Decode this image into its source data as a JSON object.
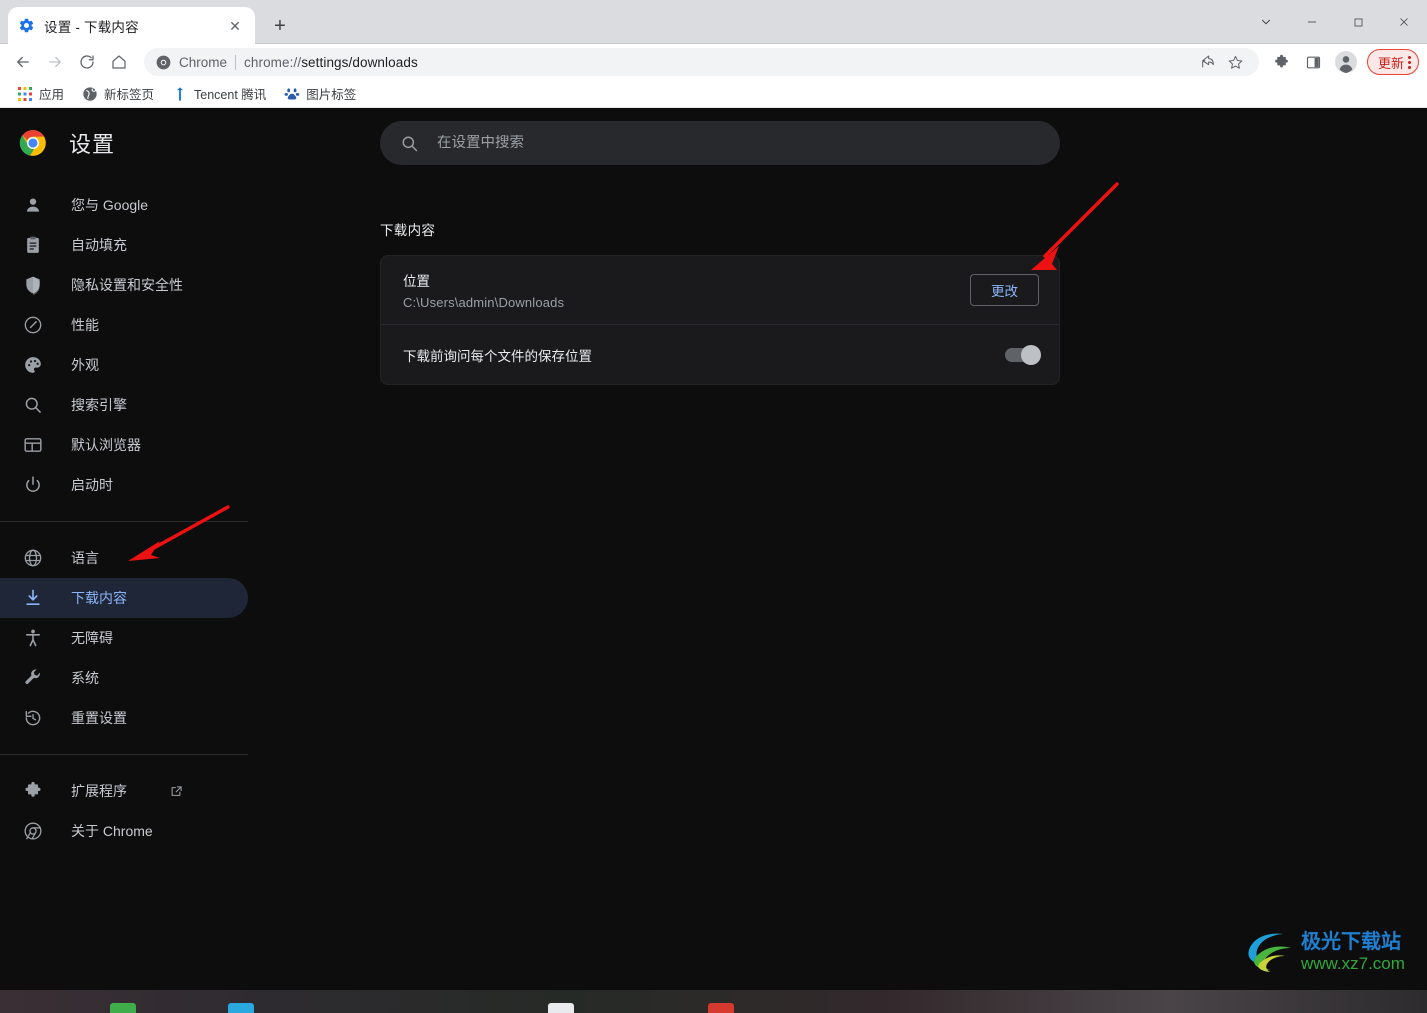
{
  "window": {
    "controls": [
      {
        "name": "tab-search",
        "glyph": "⌄"
      },
      {
        "name": "minimize",
        "glyph": "—"
      },
      {
        "name": "maximize",
        "glyph": "□"
      },
      {
        "name": "close",
        "glyph": "✕"
      }
    ]
  },
  "tab": {
    "title": "设置 - 下载内容",
    "close_glyph": "✕",
    "newtab_glyph": "+"
  },
  "toolbar": {
    "back_glyph": "←",
    "forward_glyph": "→",
    "reload_glyph": "⟳",
    "home_glyph": "⌂",
    "omnibox": {
      "app_label": "Chrome",
      "url_scheme": "chrome://",
      "url_path": "settings/downloads"
    },
    "share_label": "分享",
    "bookmark_label": "收藏",
    "extensions_label": "扩展程序",
    "sidepanel_label": "侧边栏",
    "profile_label": "个人资料",
    "update_label": "更新"
  },
  "bookmarks": [
    {
      "label": "应用",
      "icon": "apps-grid-icon"
    },
    {
      "label": "新标签页",
      "icon": "globe-icon"
    },
    {
      "label": "Tencent 腾讯",
      "icon": "tencent-icon"
    },
    {
      "label": "图片标签",
      "icon": "baidu-icon"
    }
  ],
  "sidebar": {
    "title": "设置",
    "items": [
      {
        "label": "您与 Google",
        "icon": "person-icon",
        "selected": false
      },
      {
        "label": "自动填充",
        "icon": "clipboard-icon",
        "selected": false
      },
      {
        "label": "隐私设置和安全性",
        "icon": "shield-icon",
        "selected": false
      },
      {
        "label": "性能",
        "icon": "speedometer-icon",
        "selected": false
      },
      {
        "label": "外观",
        "icon": "palette-icon",
        "selected": false
      },
      {
        "label": "搜索引擎",
        "icon": "search-icon",
        "selected": false
      },
      {
        "label": "默认浏览器",
        "icon": "browser-window-icon",
        "selected": false
      },
      {
        "label": "启动时",
        "icon": "power-icon",
        "selected": false
      }
    ],
    "items_group2": [
      {
        "label": "语言",
        "icon": "globe-icon",
        "selected": false
      },
      {
        "label": "下载内容",
        "icon": "download-icon",
        "selected": true
      },
      {
        "label": "无障碍",
        "icon": "accessibility-icon",
        "selected": false
      },
      {
        "label": "系统",
        "icon": "wrench-icon",
        "selected": false
      },
      {
        "label": "重置设置",
        "icon": "history-restore-icon",
        "selected": false
      }
    ],
    "items_group3": [
      {
        "label": "扩展程序",
        "icon": "puzzle-icon",
        "external": true,
        "selected": false
      },
      {
        "label": "关于 Chrome",
        "icon": "chrome-icon",
        "external": false,
        "selected": false
      }
    ]
  },
  "search": {
    "placeholder": "在设置中搜索",
    "value": ""
  },
  "main": {
    "section_title": "下载内容",
    "location_row": {
      "title": "位置",
      "path": "C:\\Users\\admin\\Downloads",
      "change_label": "更改"
    },
    "ask_row": {
      "label": "下载前询问每个文件的保存位置",
      "toggle_state": "off"
    }
  },
  "watermark": {
    "title": "极光下载站",
    "url": "www.xz7.com"
  },
  "colors": {
    "accent_blue": "#8ab4f8",
    "selected_pill": "#1f2637",
    "page_bg": "#0d0d0d",
    "card_bg": "#1a1a1c",
    "annotation_red": "#ee1111",
    "update_red": "#c5221f"
  }
}
